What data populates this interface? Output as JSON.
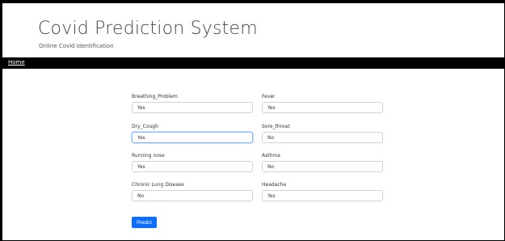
{
  "header": {
    "title": "Covid Prediction System",
    "subtitle": "Online Covid Identification"
  },
  "nav": {
    "home_label": "Home"
  },
  "form": {
    "fields": [
      {
        "label": "Breathing_Problem",
        "value": "Yes"
      },
      {
        "label": "Fever",
        "value": "Yes"
      },
      {
        "label": "Dry_Cough",
        "value": "Yes"
      },
      {
        "label": "Sore_throat",
        "value": "No"
      },
      {
        "label": "Running nose",
        "value": "Yes"
      },
      {
        "label": "Asthma",
        "value": "No"
      },
      {
        "label": "Chronic Lung Disease",
        "value": "No"
      },
      {
        "label": "Headache",
        "value": "Yes"
      }
    ],
    "submit_label": "Predict"
  },
  "colors": {
    "navbar": "#000000",
    "primary": "#0d6efd"
  }
}
